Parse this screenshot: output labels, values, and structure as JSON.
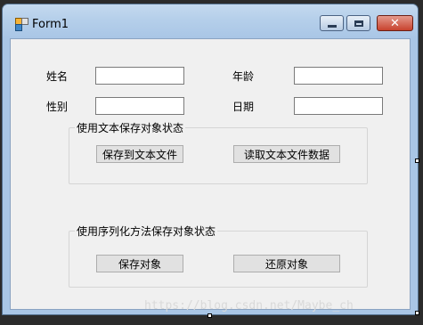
{
  "window": {
    "title": "Form1",
    "close_glyph": "✕"
  },
  "form": {
    "name_label": "姓名",
    "age_label": "年龄",
    "gender_label": "性别",
    "date_label": "日期",
    "name_value": "",
    "age_value": "",
    "gender_value": "",
    "date_value": ""
  },
  "group_text": {
    "legend": "使用文本保存对象状态",
    "save_button": "保存到文本文件",
    "read_button": "读取文本文件数据"
  },
  "group_serialize": {
    "legend": "使用序列化方法保存对象状态",
    "save_button": "保存对象",
    "restore_button": "还原对象"
  },
  "watermark": "https://blog.csdn.net/Maybe_ch"
}
